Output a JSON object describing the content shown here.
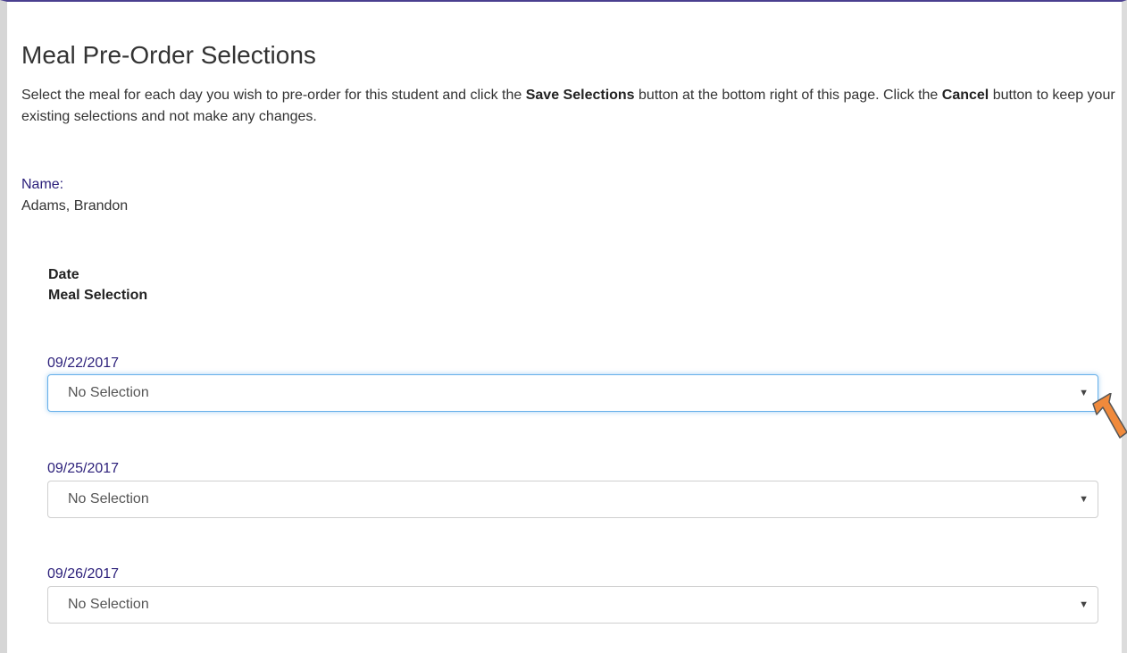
{
  "page": {
    "title": "Meal Pre-Order Selections",
    "intro": {
      "part1": "Select the meal for each day you wish to pre-order for this student and click the ",
      "save_bold": "Save Selections",
      "part2": " button at the bottom right of this page. Click the ",
      "cancel_bold": "Cancel",
      "part3": " button to keep your existing selections and not make any changes."
    }
  },
  "student": {
    "name_label": "Name:",
    "name_value": "Adams, Brandon"
  },
  "table": {
    "headers": [
      "Date",
      "Meal Selection"
    ],
    "rows": [
      {
        "date": "09/22/2017",
        "selection": "No Selection"
      },
      {
        "date": "09/25/2017",
        "selection": "No Selection"
      },
      {
        "date": "09/26/2017",
        "selection": "No Selection"
      }
    ]
  },
  "colors": {
    "label_accent": "#2b1f7a",
    "focus_border": "#66afe9",
    "annotation_arrow": "#f08a3c",
    "top_border": "#4a3f8f"
  },
  "icons": {
    "dropdown": "caret-down-icon",
    "annotation": "annotation-arrow-icon"
  }
}
